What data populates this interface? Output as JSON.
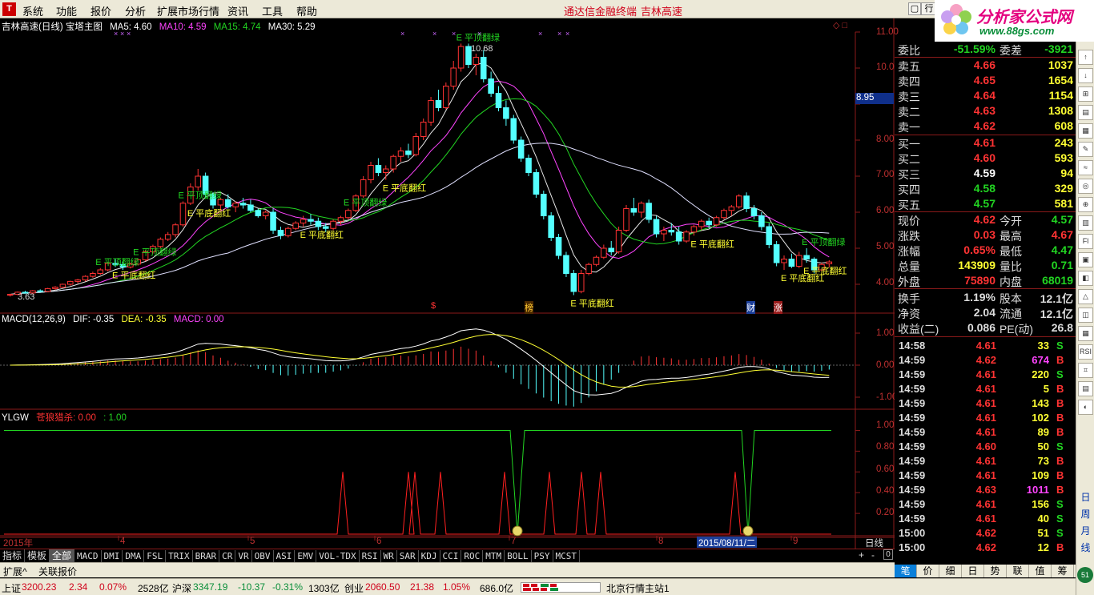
{
  "menu": {
    "items": [
      "系统",
      "功能",
      "报价",
      "分析",
      "扩展市场行情",
      "资讯",
      "工具",
      "帮助"
    ],
    "center_title": "通达信金融终端",
    "stock_name_title": "吉林高速",
    "right_btn": "行"
  },
  "logo": {
    "text": "分析家公式网",
    "url": "www.88gs.com"
  },
  "main_chart": {
    "title": "吉林高速(日线) 宝塔主图",
    "ma5": "MA5: 4.60",
    "ma10": "MA10: 4.59",
    "ma15": "MA15: 4.74",
    "ma30": "MA30: 5.29",
    "y_ticks": [
      "11.00",
      "10.00",
      "9.00",
      "8.00",
      "7.00",
      "6.00",
      "5.00",
      "4.00"
    ],
    "current_price_tag": "8.95",
    "high_label": "10.68",
    "low_label": "3.63",
    "signal_top": "平顶翻绿",
    "signal_bottom": "平底翻红",
    "markers": [
      "$",
      "榜",
      "财",
      "涨"
    ]
  },
  "macd": {
    "title": "MACD(12,26,9)",
    "dif": "DIF: -0.35",
    "dea": "DEA: -0.35",
    "macd": "MACD: 0.00",
    "y_ticks": [
      "1.00",
      "0.00",
      "-1.00"
    ]
  },
  "ylgw": {
    "title": "YLGW",
    "name": "苍狼猎杀: 0.00",
    "val": ": 1.00",
    "y_ticks": [
      "1.00",
      "0.80",
      "0.60",
      "0.40",
      "0.20"
    ]
  },
  "x_axis": {
    "year": "2015年",
    "months": [
      "4",
      "5",
      "6",
      "7",
      "8",
      "9"
    ],
    "cursor_date": "2015/08/11/二",
    "period": "日线"
  },
  "indicator_tabs": [
    "指标",
    "模板",
    "全部",
    "MACD",
    "DMI",
    "DMA",
    "FSL",
    "TRIX",
    "BRAR",
    "CR",
    "VR",
    "OBV",
    "ASI",
    "EMV",
    "VOL-TDX",
    "RSI",
    "WR",
    "SAR",
    "KDJ",
    "CCI",
    "ROC",
    "MTM",
    "BOLL",
    "PSY",
    "MCST"
  ],
  "bottom_tabs": [
    "扩展^",
    "关联报价"
  ],
  "order_book": {
    "ratio_label": "委比",
    "ratio_value": "-51.59%",
    "diff_label": "委差",
    "diff_value": "-3921",
    "sell": [
      {
        "label": "卖五",
        "price": "4.66",
        "vol": "1037"
      },
      {
        "label": "卖四",
        "price": "4.65",
        "vol": "1654"
      },
      {
        "label": "卖三",
        "price": "4.64",
        "vol": "1154"
      },
      {
        "label": "卖二",
        "price": "4.63",
        "vol": "1308"
      },
      {
        "label": "卖一",
        "price": "4.62",
        "vol": "608"
      }
    ],
    "buy": [
      {
        "label": "买一",
        "price": "4.61",
        "vol": "243"
      },
      {
        "label": "买二",
        "price": "4.60",
        "vol": "593"
      },
      {
        "label": "买三",
        "price": "4.59",
        "vol": "94"
      },
      {
        "label": "买四",
        "price": "4.58",
        "vol": "329"
      },
      {
        "label": "买五",
        "price": "4.57",
        "vol": "581"
      }
    ]
  },
  "stats": [
    {
      "l1": "现价",
      "v1": "4.62",
      "c1": "#ff3333",
      "l2": "今开",
      "v2": "4.57",
      "c2": "#22d522"
    },
    {
      "l1": "涨跌",
      "v1": "0.03",
      "c1": "#ff3333",
      "l2": "最高",
      "v2": "4.67",
      "c2": "#ff3333"
    },
    {
      "l1": "涨幅",
      "v1": "0.65%",
      "c1": "#ff3333",
      "l2": "最低",
      "v2": "4.47",
      "c2": "#22d522"
    },
    {
      "l1": "总量",
      "v1": "143909",
      "c1": "#ffff33",
      "l2": "量比",
      "v2": "0.71",
      "c2": "#22d522"
    },
    {
      "l1": "外盘",
      "v1": "75890",
      "c1": "#ff3333",
      "l2": "内盘",
      "v2": "68019",
      "c2": "#22d522"
    },
    {
      "l1": "换手",
      "v1": "1.19%",
      "c1": "#dddddd",
      "l2": "股本",
      "v2": "12.1亿",
      "c2": "#dddddd"
    },
    {
      "l1": "净资",
      "v1": "2.04",
      "c1": "#dddddd",
      "l2": "流通",
      "v2": "12.1亿",
      "c2": "#dddddd"
    },
    {
      "l1": "收益(二)",
      "v1": "0.086",
      "c1": "#dddddd",
      "l2": "PE(动)",
      "v2": "26.8",
      "c2": "#dddddd"
    }
  ],
  "ticks": [
    {
      "t": "14:58",
      "p": "4.61",
      "pc": "#ff3333",
      "v": "33",
      "vc": "#ffff33",
      "s": "S",
      "sc": "#22d522"
    },
    {
      "t": "14:59",
      "p": "4.62",
      "pc": "#ff3333",
      "v": "674",
      "vc": "#ff44ff",
      "s": "B",
      "sc": "#ff3333"
    },
    {
      "t": "14:59",
      "p": "4.61",
      "pc": "#ff3333",
      "v": "220",
      "vc": "#ffff33",
      "s": "S",
      "sc": "#22d522"
    },
    {
      "t": "14:59",
      "p": "4.61",
      "pc": "#ff3333",
      "v": "5",
      "vc": "#ffff33",
      "s": "B",
      "sc": "#ff3333"
    },
    {
      "t": "14:59",
      "p": "4.61",
      "pc": "#ff3333",
      "v": "143",
      "vc": "#ffff33",
      "s": "B",
      "sc": "#ff3333"
    },
    {
      "t": "14:59",
      "p": "4.61",
      "pc": "#ff3333",
      "v": "102",
      "vc": "#ffff33",
      "s": "B",
      "sc": "#ff3333"
    },
    {
      "t": "14:59",
      "p": "4.61",
      "pc": "#ff3333",
      "v": "89",
      "vc": "#ffff33",
      "s": "B",
      "sc": "#ff3333"
    },
    {
      "t": "14:59",
      "p": "4.60",
      "pc": "#ff3333",
      "v": "50",
      "vc": "#ffff33",
      "s": "S",
      "sc": "#22d522"
    },
    {
      "t": "14:59",
      "p": "4.61",
      "pc": "#ff3333",
      "v": "73",
      "vc": "#ffff33",
      "s": "B",
      "sc": "#ff3333"
    },
    {
      "t": "14:59",
      "p": "4.61",
      "pc": "#ff3333",
      "v": "109",
      "vc": "#ffff33",
      "s": "B",
      "sc": "#ff3333"
    },
    {
      "t": "14:59",
      "p": "4.63",
      "pc": "#ff3333",
      "v": "1011",
      "vc": "#ff44ff",
      "s": "B",
      "sc": "#ff3333"
    },
    {
      "t": "14:59",
      "p": "4.61",
      "pc": "#ff3333",
      "v": "156",
      "vc": "#ffff33",
      "s": "S",
      "sc": "#22d522"
    },
    {
      "t": "14:59",
      "p": "4.61",
      "pc": "#ff3333",
      "v": "40",
      "vc": "#ffff33",
      "s": "S",
      "sc": "#22d522"
    },
    {
      "t": "15:00",
      "p": "4.62",
      "pc": "#ff3333",
      "v": "51",
      "vc": "#ffff33",
      "s": "S",
      "sc": "#22d522"
    },
    {
      "t": "15:00",
      "p": "4.62",
      "pc": "#ff3333",
      "v": "12",
      "vc": "#ffff33",
      "s": "B",
      "sc": "#ff3333"
    }
  ],
  "right_tabs": [
    "笔",
    "价",
    "细",
    "日",
    "势",
    "联",
    "值",
    "筹"
  ],
  "sidebar_text": [
    "日",
    "周",
    "月",
    "线"
  ],
  "statusbar": {
    "sh_label": "上证",
    "sh_val": "3200.23",
    "sh_chg": "2.34",
    "sh_pct": "0.07%",
    "sh_amt": "2528亿",
    "hs_label": "沪深",
    "hs_val": "3347.19",
    "hs_chg": "-10.37",
    "hs_pct": "-0.31%",
    "hs_amt": "1303亿",
    "cy_label": "创业",
    "cy_val": "2060.50",
    "cy_chg": "21.38",
    "cy_pct": "1.05%",
    "cy_amt": "686.0亿",
    "server": "北京行情主站1"
  },
  "chart_data": {
    "type": "candlestick",
    "ylim": [
      3.6,
      11.2
    ],
    "candles": [
      [
        3.7,
        3.74,
        3.66,
        3.72
      ],
      [
        3.72,
        3.8,
        3.7,
        3.78
      ],
      [
        3.78,
        3.82,
        3.74,
        3.76
      ],
      [
        3.76,
        3.84,
        3.72,
        3.82
      ],
      [
        3.82,
        3.86,
        3.78,
        3.8
      ],
      [
        3.8,
        3.9,
        3.78,
        3.88
      ],
      [
        3.88,
        3.95,
        3.84,
        3.92
      ],
      [
        3.92,
        4.02,
        3.9,
        4.0
      ],
      [
        4.0,
        4.1,
        3.96,
        4.08
      ],
      [
        4.08,
        4.15,
        4.02,
        4.12
      ],
      [
        4.12,
        4.25,
        4.08,
        4.22
      ],
      [
        4.22,
        4.35,
        4.18,
        4.3
      ],
      [
        4.3,
        4.45,
        4.26,
        4.4
      ],
      [
        4.4,
        4.62,
        4.36,
        4.58
      ],
      [
        4.58,
        4.7,
        4.48,
        4.55
      ],
      [
        4.55,
        4.62,
        4.4,
        4.48
      ],
      [
        4.48,
        4.6,
        4.44,
        4.56
      ],
      [
        4.56,
        4.72,
        4.52,
        4.68
      ],
      [
        4.68,
        4.95,
        4.64,
        4.9
      ],
      [
        4.9,
        5.1,
        4.85,
        5.05
      ],
      [
        5.05,
        5.3,
        5.0,
        5.25
      ],
      [
        5.25,
        5.45,
        5.2,
        5.38
      ],
      [
        5.38,
        5.7,
        5.3,
        5.65
      ],
      [
        5.65,
        6.3,
        5.6,
        6.25
      ],
      [
        6.25,
        6.8,
        6.2,
        6.7
      ],
      [
        6.7,
        7.2,
        6.6,
        7.0
      ],
      [
        7.0,
        7.1,
        6.4,
        6.5
      ],
      [
        6.5,
        6.55,
        6.1,
        6.2
      ],
      [
        6.2,
        6.4,
        6.05,
        6.35
      ],
      [
        6.35,
        6.5,
        6.1,
        6.15
      ],
      [
        6.15,
        6.3,
        6.0,
        6.25
      ],
      [
        6.25,
        6.4,
        6.1,
        6.2
      ],
      [
        6.2,
        6.35,
        6.0,
        6.05
      ],
      [
        6.05,
        6.1,
        5.85,
        5.9
      ],
      [
        5.9,
        6.05,
        5.8,
        6.0
      ],
      [
        6.0,
        6.1,
        5.4,
        5.5
      ],
      [
        5.5,
        5.6,
        5.25,
        5.35
      ],
      [
        5.35,
        5.6,
        5.3,
        5.55
      ],
      [
        5.55,
        5.75,
        5.5,
        5.7
      ],
      [
        5.7,
        5.9,
        5.6,
        5.8
      ],
      [
        5.8,
        5.95,
        5.65,
        5.75
      ],
      [
        5.75,
        5.85,
        5.5,
        5.6
      ],
      [
        5.6,
        5.7,
        5.45,
        5.55
      ],
      [
        5.55,
        5.8,
        5.5,
        5.75
      ],
      [
        5.75,
        5.9,
        5.65,
        5.85
      ],
      [
        5.85,
        6.1,
        5.8,
        6.05
      ],
      [
        6.05,
        6.5,
        6.0,
        6.45
      ],
      [
        6.45,
        7.0,
        6.4,
        6.9
      ],
      [
        6.9,
        7.4,
        6.8,
        7.3
      ],
      [
        7.3,
        7.5,
        7.0,
        7.1
      ],
      [
        7.1,
        7.3,
        6.9,
        7.2
      ],
      [
        7.2,
        7.6,
        7.1,
        7.55
      ],
      [
        7.55,
        7.8,
        7.4,
        7.7
      ],
      [
        7.7,
        7.9,
        7.5,
        7.6
      ],
      [
        7.6,
        8.2,
        7.55,
        8.1
      ],
      [
        8.1,
        8.6,
        8.0,
        8.5
      ],
      [
        8.5,
        9.2,
        8.4,
        9.1
      ],
      [
        9.1,
        9.4,
        8.8,
        8.9
      ],
      [
        8.9,
        9.6,
        8.85,
        9.5
      ],
      [
        9.5,
        10.2,
        9.4,
        10.0
      ],
      [
        10.0,
        10.68,
        9.9,
        10.6
      ],
      [
        10.6,
        10.68,
        10.0,
        10.1
      ],
      [
        10.1,
        10.4,
        9.8,
        10.3
      ],
      [
        10.3,
        10.5,
        9.6,
        9.7
      ],
      [
        9.7,
        9.9,
        9.2,
        9.3
      ],
      [
        9.3,
        9.5,
        8.8,
        8.9
      ],
      [
        8.9,
        9.1,
        8.4,
        8.6
      ],
      [
        8.6,
        8.7,
        7.9,
        8.0
      ],
      [
        8.0,
        8.1,
        7.4,
        7.5
      ],
      [
        7.5,
        7.6,
        7.0,
        7.1
      ],
      [
        7.1,
        7.2,
        6.4,
        6.5
      ],
      [
        6.5,
        6.6,
        5.8,
        5.9
      ],
      [
        5.9,
        6.0,
        5.2,
        5.3
      ],
      [
        5.3,
        5.4,
        4.7,
        4.8
      ],
      [
        4.8,
        4.9,
        4.2,
        4.3
      ],
      [
        4.3,
        4.4,
        3.7,
        3.8
      ],
      [
        3.8,
        4.4,
        3.75,
        4.3
      ],
      [
        4.3,
        4.6,
        4.25,
        4.55
      ],
      [
        4.55,
        4.8,
        4.5,
        4.75
      ],
      [
        4.75,
        5.1,
        4.7,
        5.0
      ],
      [
        5.0,
        5.2,
        4.8,
        4.9
      ],
      [
        4.9,
        5.6,
        4.85,
        5.5
      ],
      [
        5.5,
        6.2,
        5.45,
        6.1
      ],
      [
        6.1,
        6.4,
        5.9,
        6.0
      ],
      [
        6.0,
        6.3,
        5.85,
        6.25
      ],
      [
        6.25,
        6.35,
        5.7,
        5.8
      ],
      [
        5.8,
        5.9,
        5.3,
        5.4
      ],
      [
        5.4,
        5.6,
        5.2,
        5.5
      ],
      [
        5.5,
        5.7,
        5.35,
        5.45
      ],
      [
        5.45,
        5.6,
        5.1,
        5.2
      ],
      [
        5.2,
        5.5,
        5.15,
        5.45
      ],
      [
        5.45,
        5.65,
        5.35,
        5.6
      ],
      [
        5.6,
        5.8,
        5.5,
        5.75
      ],
      [
        5.75,
        5.85,
        5.55,
        5.65
      ],
      [
        5.65,
        5.9,
        5.6,
        5.85
      ],
      [
        5.85,
        6.1,
        5.8,
        6.05
      ],
      [
        6.05,
        6.2,
        5.9,
        6.15
      ],
      [
        6.15,
        6.5,
        6.1,
        6.45
      ],
      [
        6.45,
        6.55,
        6.0,
        6.1
      ],
      [
        6.1,
        6.2,
        5.8,
        5.9
      ],
      [
        5.9,
        6.0,
        5.5,
        5.6
      ],
      [
        5.6,
        5.7,
        5.0,
        5.1
      ],
      [
        5.1,
        5.2,
        4.5,
        4.6
      ],
      [
        4.6,
        4.8,
        4.4,
        4.7
      ],
      [
        4.7,
        4.85,
        4.45,
        4.5
      ],
      [
        4.5,
        4.9,
        4.45,
        4.8
      ],
      [
        4.8,
        5.0,
        4.6,
        4.7
      ],
      [
        4.7,
        4.75,
        4.3,
        4.4
      ],
      [
        4.4,
        4.6,
        4.35,
        4.55
      ],
      [
        4.57,
        4.67,
        4.47,
        4.62
      ]
    ]
  }
}
